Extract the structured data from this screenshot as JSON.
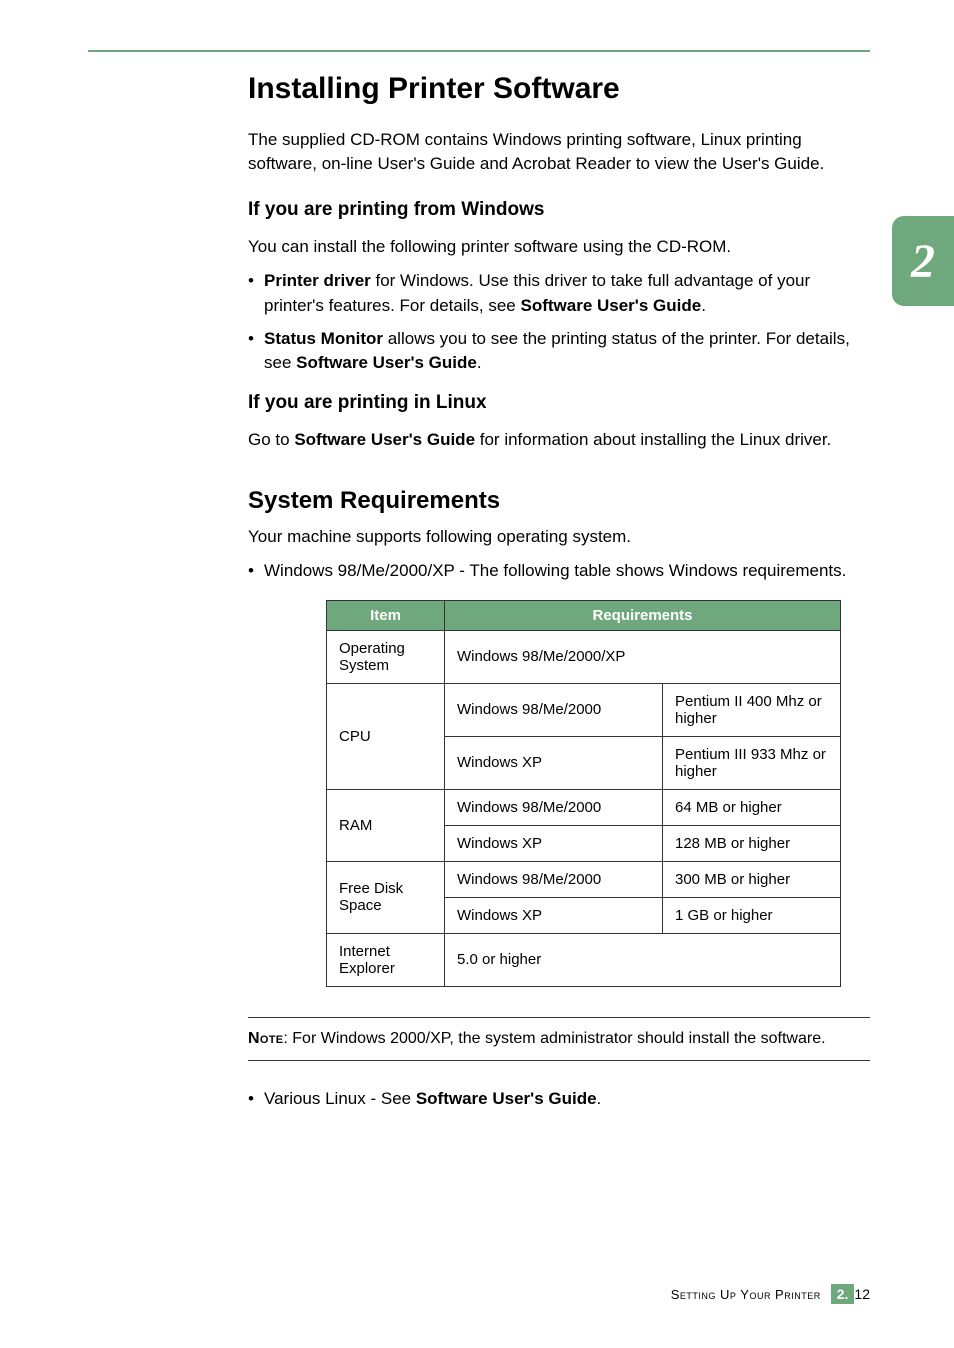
{
  "chapter_number": "2",
  "heading": "Installing Printer Software",
  "intro": "The supplied CD-ROM contains Windows printing software, Linux printing software, on-line User's Guide and Acrobat Reader to view the User's Guide.",
  "windows_heading": "If you are printing from Windows",
  "windows_para": "You can install the following printer software using the CD-ROM.",
  "bullets_windows": {
    "b1_pre": "Printer driver",
    "b1_mid": " for Windows. Use this driver to take full advantage of your printer's features. For details, see ",
    "b1_bold": "Software User's Guide",
    "b1_end": ".",
    "b2_pre": "Status Monitor",
    "b2_mid": " allows you to see the printing status of the printer. For details, see ",
    "b2_bold": "Software User's Guide",
    "b2_end": "."
  },
  "linux_heading": "If you are printing in Linux",
  "linux_para_pre": "Go to ",
  "linux_para_bold": "Software User's Guide",
  "linux_para_end": " for information about installing the Linux driver.",
  "req_heading": "System Requirements",
  "req_para": "Your machine supports following operating system.",
  "req_bullet": "Windows 98/Me/2000/XP - The following table shows Windows requirements.",
  "table": {
    "th_item": "Item",
    "th_req": "Requirements",
    "rows": {
      "os_label": "Operating System",
      "os_value": "Windows 98/Me/2000/XP",
      "cpu_label": "CPU",
      "cpu_r1_os": "Windows 98/Me/2000",
      "cpu_r1_val": "Pentium II 400 Mhz or higher",
      "cpu_r2_os": "Windows XP",
      "cpu_r2_val": "Pentium III 933 Mhz or higher",
      "ram_label": "RAM",
      "ram_r1_os": "Windows 98/Me/2000",
      "ram_r1_val": "64 MB or higher",
      "ram_r2_os": "Windows XP",
      "ram_r2_val": "128 MB or higher",
      "disk_label": "Free Disk Space",
      "disk_r1_os": "Windows 98/Me/2000",
      "disk_r1_val": "300 MB or higher",
      "disk_r2_os": "Windows XP",
      "disk_r2_val": "1 GB or higher",
      "ie_label": "Internet Explorer",
      "ie_value": "5.0 or higher"
    }
  },
  "note_label": "Note",
  "note_text": ": For Windows 2000/XP, the system administrator should install the software.",
  "linux_bullet_pre": "Various Linux - See ",
  "linux_bullet_bold": "Software User's Guide",
  "linux_bullet_end": ".",
  "footer_text": "Setting Up Your Printer",
  "page_badge": "2.",
  "page_number": "12"
}
